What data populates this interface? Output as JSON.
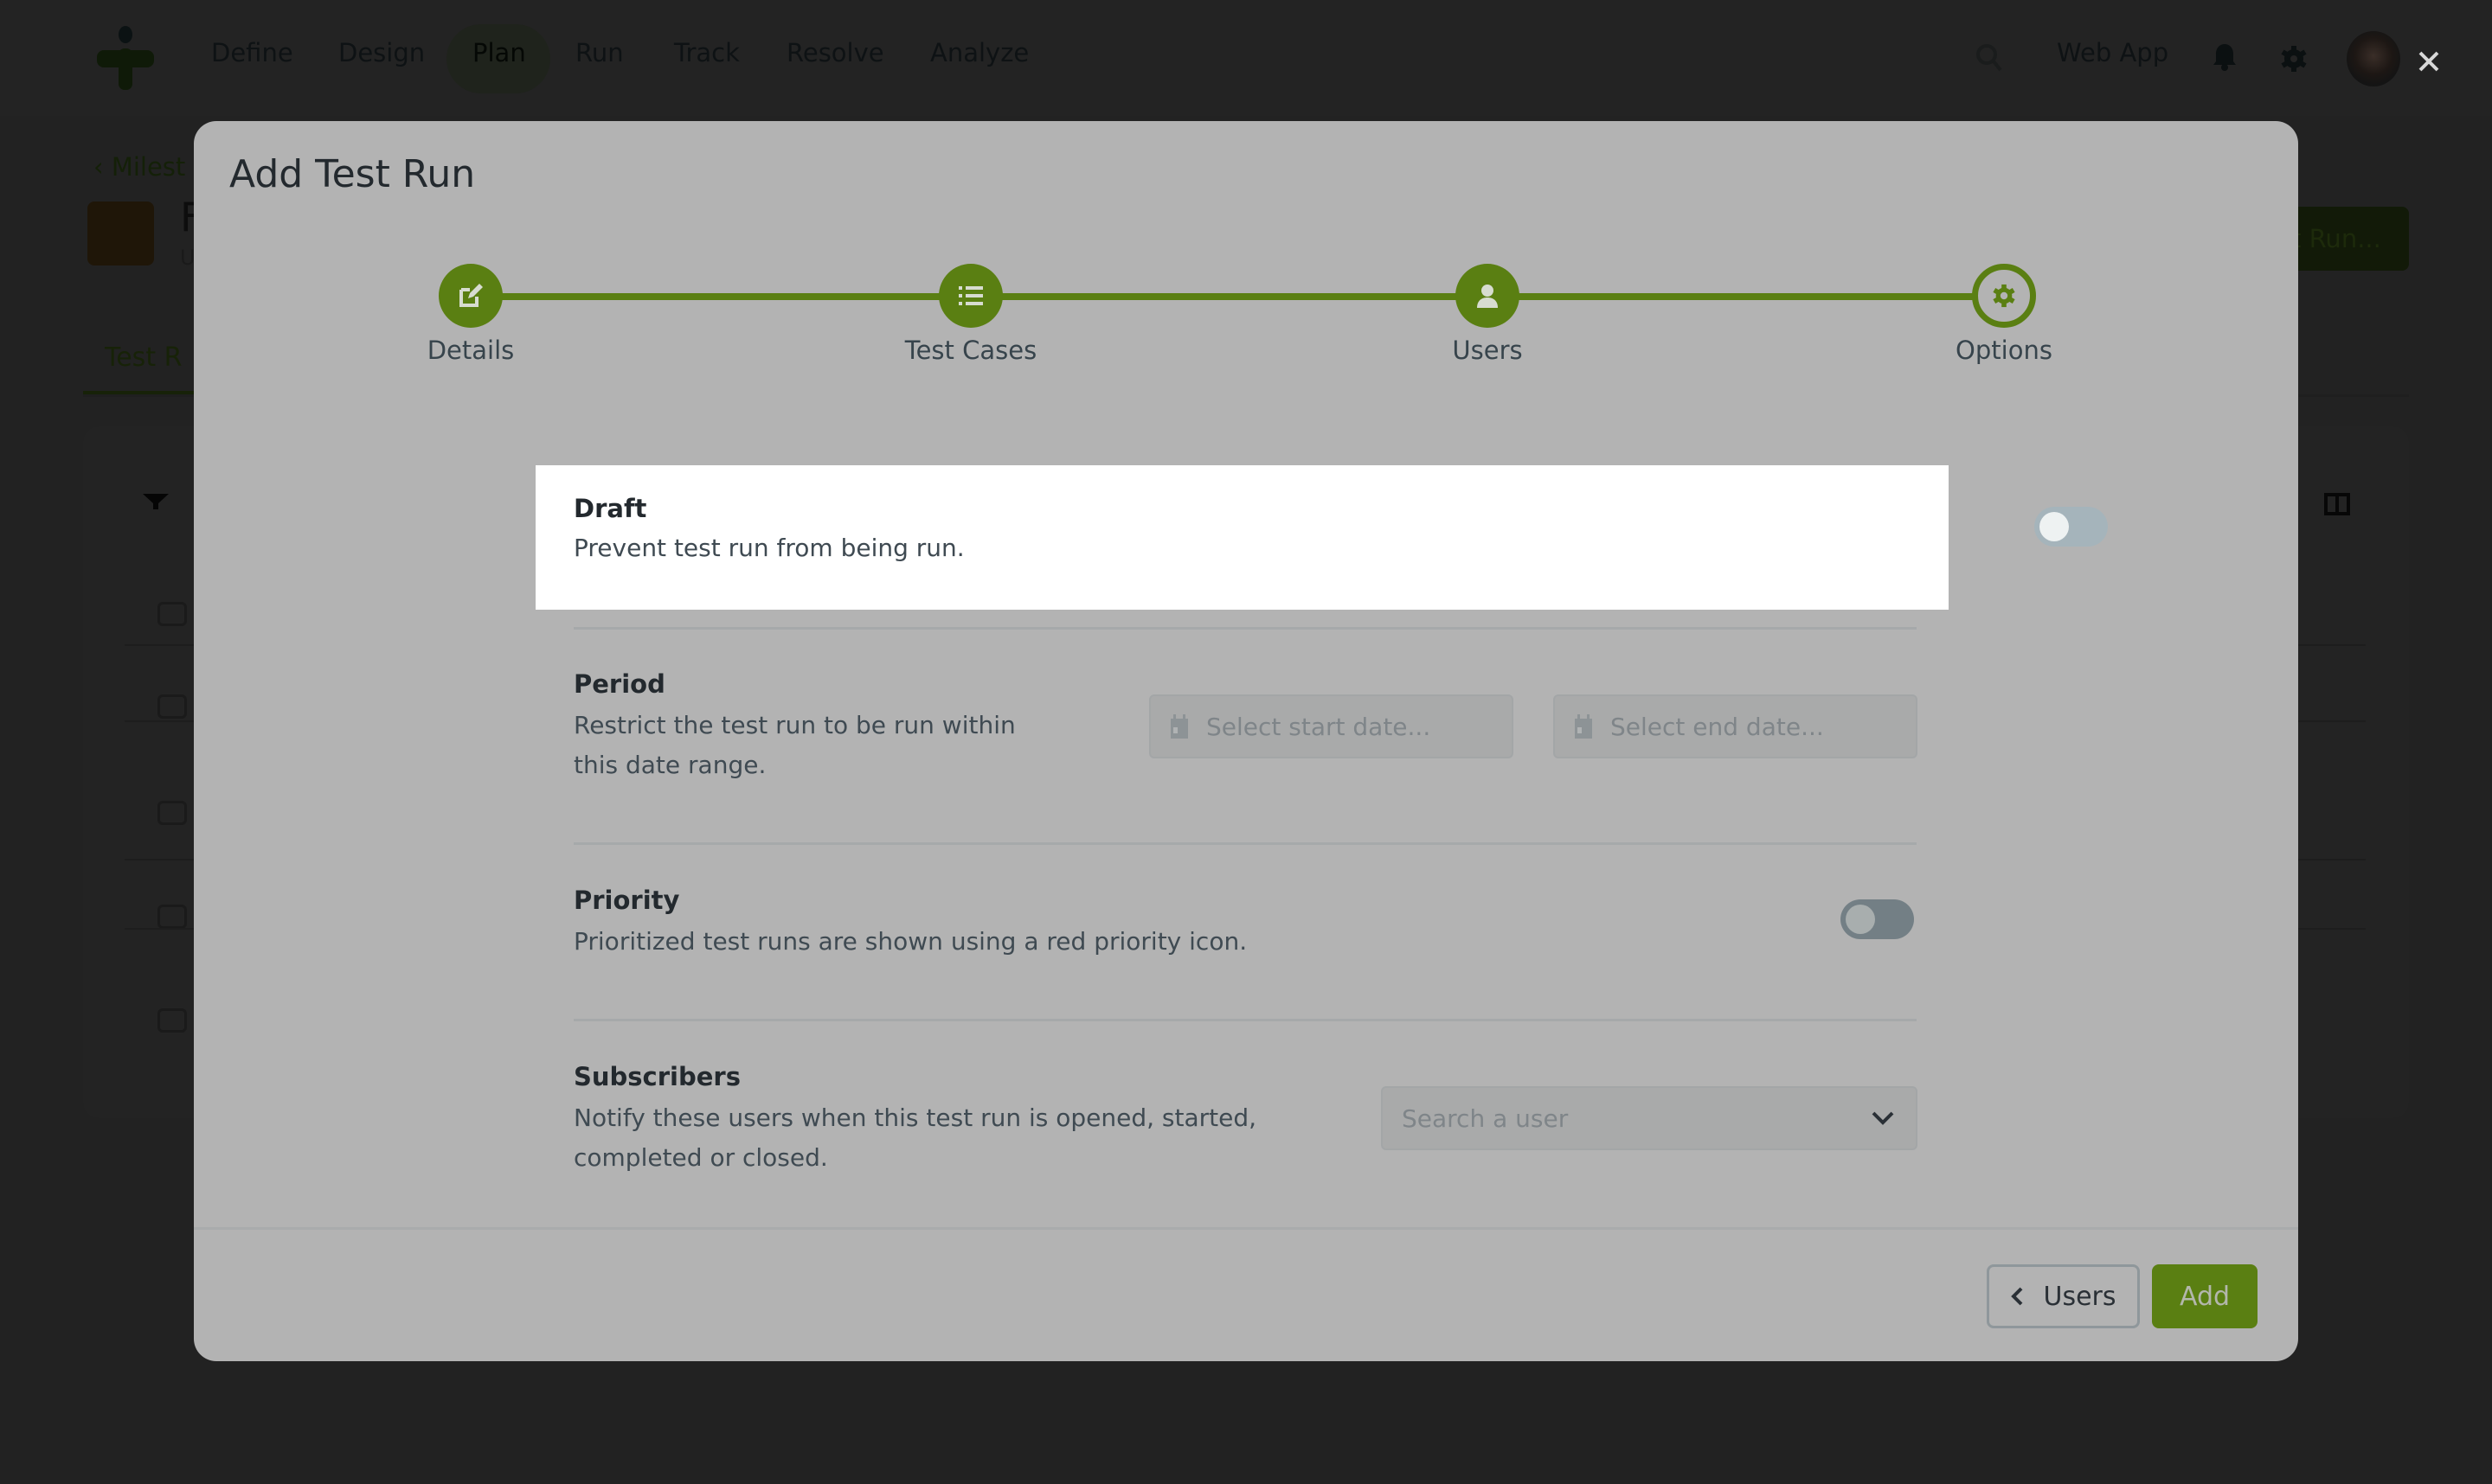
{
  "navbar": {
    "items": [
      "Define",
      "Design",
      "Plan",
      "Run",
      "Track",
      "Resolve",
      "Analyze"
    ],
    "active": "Plan",
    "project": "Web App",
    "icons": [
      "logo",
      "search-icon",
      "bell-icon",
      "gear-icon",
      "avatar"
    ]
  },
  "background": {
    "breadcrumb": "Milest",
    "title_fragment": "F",
    "subtitle_fragment": "U",
    "tab_fragment": "Test R",
    "action_button_fragment": "t Run..."
  },
  "modal": {
    "title": "Add Test Run",
    "close_icon": "close-icon",
    "steps": [
      {
        "label": "Details",
        "icon": "edit-icon",
        "state": "complete"
      },
      {
        "label": "Test Cases",
        "icon": "list-icon",
        "state": "complete"
      },
      {
        "label": "Users",
        "icon": "user-icon",
        "state": "complete"
      },
      {
        "label": "Options",
        "icon": "gear-icon",
        "state": "current"
      }
    ],
    "options": {
      "draft": {
        "title": "Draft",
        "description": "Prevent test run from being run.",
        "enabled": false
      },
      "period": {
        "title": "Period",
        "description_line1": "Restrict the test run to be run within",
        "description_line2": "this date range.",
        "start_placeholder": "Select start date...",
        "end_placeholder": "Select end date..."
      },
      "priority": {
        "title": "Priority",
        "description": "Prioritized test runs are shown using a red priority icon.",
        "enabled": false
      },
      "subscribers": {
        "title": "Subscribers",
        "description_line1": "Notify these users when this test run is opened, started,",
        "description_line2": "completed or closed.",
        "placeholder": "Search a user"
      }
    },
    "footer": {
      "back_label": "Users",
      "add_label": "Add"
    }
  },
  "colors": {
    "accent": "#5a7f12",
    "overlay_bg": "#222222",
    "modal_bg_dimmed": "#b3b3b3",
    "highlight": "#ffffff"
  }
}
